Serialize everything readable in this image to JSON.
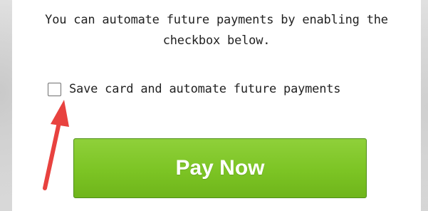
{
  "intro": {
    "line1": "You can automate future payments by enabling the",
    "line2": "checkbox below."
  },
  "save_card": {
    "label": "Save card and automate future payments",
    "checked": false
  },
  "pay_button": {
    "label": "Pay Now",
    "color": "#7cc424"
  },
  "annotation": {
    "icon": "red-arrow-icon",
    "color": "#e8423f"
  }
}
